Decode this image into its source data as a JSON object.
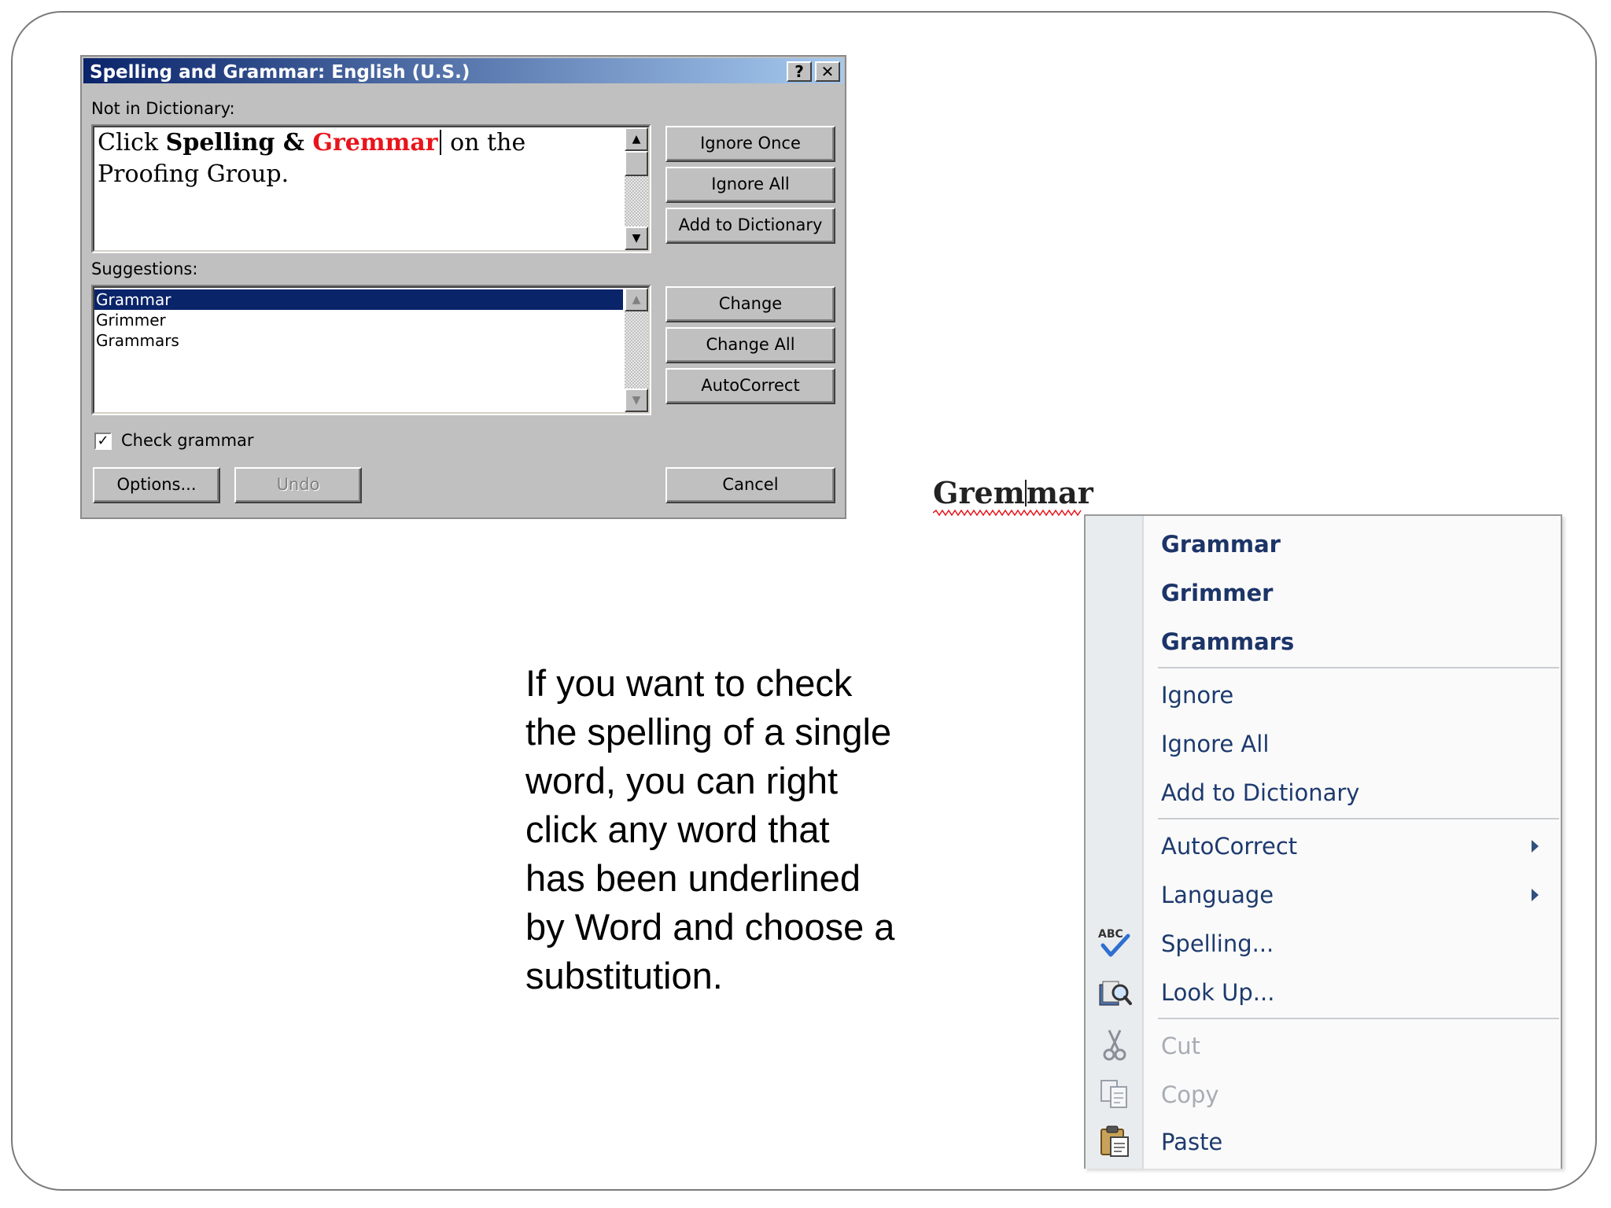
{
  "dialog": {
    "title": "Spelling and Grammar: English (U.S.)",
    "help_label": "?",
    "close_label": "✕",
    "not_in_dictionary_label": "Not in Dictionary:",
    "sentence": {
      "part1": "Click ",
      "part2": "Spelling & ",
      "bad_word": "Gremmar",
      "part3": " on the Proofing Group."
    },
    "suggestions_label": "Suggestions:",
    "suggestions": [
      "Grammar",
      "Grimmer",
      "Grammars"
    ],
    "check_grammar_label": "Check grammar",
    "buttons": {
      "ignore_once": "Ignore Once",
      "ignore_all": "Ignore All",
      "add_to_dictionary": "Add to Dictionary",
      "change": "Change",
      "change_all": "Change All",
      "autocorrect": "AutoCorrect",
      "options": "Options...",
      "undo": "Undo",
      "cancel": "Cancel"
    }
  },
  "instruction_text": "If you want to check the spelling of a single word, you can right click any word that has been underlined by Word and choose a substitution.",
  "misspelled_word": {
    "before_caret": "Grem",
    "after_caret": "mar"
  },
  "context_menu": {
    "suggestions": [
      "Grammar",
      "Grimmer",
      "Grammars"
    ],
    "ignore": "Ignore",
    "ignore_all": "Ignore All",
    "add_to_dictionary": "Add to Dictionary",
    "autocorrect": "AutoCorrect",
    "language": "Language",
    "spelling": "Spelling...",
    "look_up": "Look Up...",
    "cut": "Cut",
    "copy": "Copy",
    "paste": "Paste",
    "spelling_icon_text": "ABC"
  },
  "colors": {
    "title_bar_start": "#0a246a",
    "error_red": "#e8141a",
    "menu_text": "#1d3a6e"
  }
}
